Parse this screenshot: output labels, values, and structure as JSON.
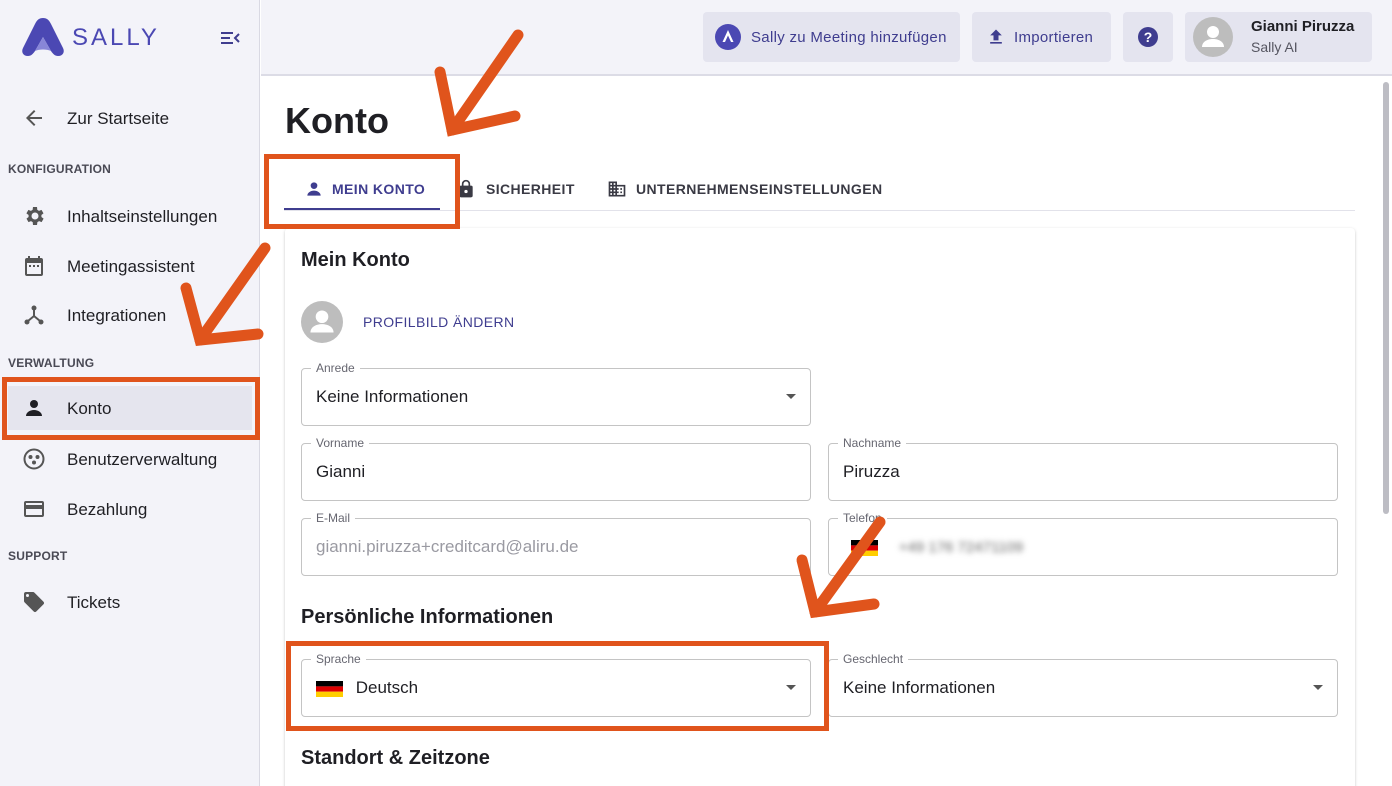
{
  "sidebar": {
    "brand": "SALLY",
    "items": {
      "home": "Zur Startseite",
      "content_settings": "Inhaltseinstellungen",
      "meeting_assistant": "Meetingassistent",
      "integrations": "Integrationen",
      "account": "Konto",
      "user_management": "Benutzerverwaltung",
      "billing": "Bezahlung",
      "tickets": "Tickets"
    },
    "sections": {
      "configuration": "KONFIGURATION",
      "administration": "VERWALTUNG",
      "support": "SUPPORT"
    }
  },
  "topbar": {
    "add_meeting": "Sally zu Meeting hinzufügen",
    "import": "Importieren",
    "help_icon": "help-circle-icon",
    "user": {
      "name": "Gianni Piruzza",
      "org": "Sally AI"
    }
  },
  "page": {
    "title": "Konto",
    "tabs": {
      "my_account": "MEIN KONTO",
      "security": "SICHERHEIT",
      "company_settings": "UNTERNEHMENSEINSTELLUNGEN"
    }
  },
  "form": {
    "section_title": "Mein Konto",
    "change_picture": "PROFILBILD ÄNDERN",
    "salutation": {
      "label": "Anrede",
      "value": "Keine Informationen"
    },
    "first_name": {
      "label": "Vorname",
      "value": "Gianni"
    },
    "last_name": {
      "label": "Nachname",
      "value": "Piruzza"
    },
    "email": {
      "label": "E-Mail",
      "value": "gianni.piruzza+creditcard@aliru.de"
    },
    "phone": {
      "label": "Telefon",
      "value": "+49 176 72471109"
    },
    "personal_title": "Persönliche Informationen",
    "language": {
      "label": "Sprache",
      "value": "Deutsch"
    },
    "gender": {
      "label": "Geschlecht",
      "value": "Keine Informationen"
    },
    "location_title": "Standort & Zeitzone"
  },
  "colors": {
    "accent": "#3f3d8f",
    "annotation": "#e0541c",
    "sidebar_bg": "#f3f3f9"
  }
}
